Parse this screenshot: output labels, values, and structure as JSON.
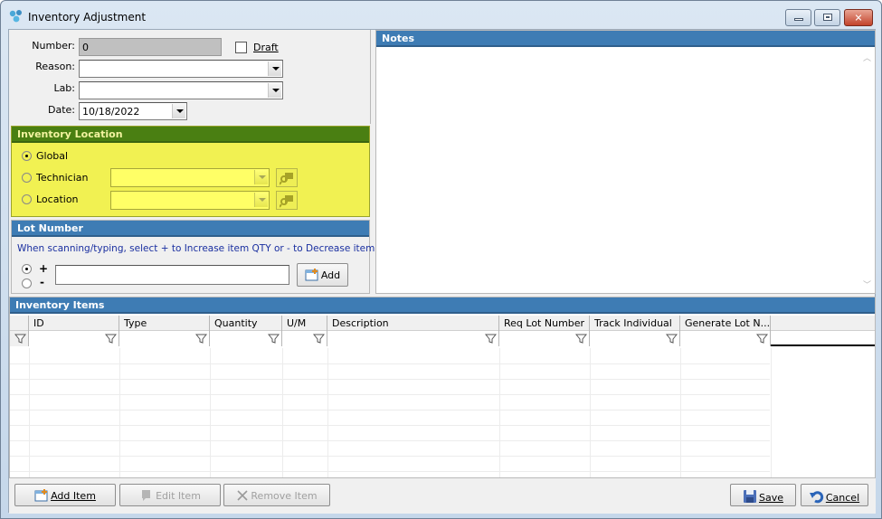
{
  "window": {
    "title": "Inventory Adjustment",
    "controls": {
      "minimize": "minimize",
      "maximize": "maximize",
      "close": "✕"
    }
  },
  "header_form": {
    "number_label": "Number:",
    "number_value": "0",
    "draft_label": "Draft",
    "draft_checked": false,
    "reason_label": "Reason:",
    "reason_value": "",
    "lab_label": "Lab:",
    "lab_value": "",
    "date_label": "Date:",
    "date_value": "10/18/2022"
  },
  "inventory_location": {
    "title": "Inventory Location",
    "options": [
      {
        "label": "Global",
        "selected": true
      },
      {
        "label": "Technician",
        "selected": false,
        "value": ""
      },
      {
        "label": "Location",
        "selected": false,
        "value": ""
      }
    ]
  },
  "lot_number": {
    "title": "Lot Number",
    "hint": "When scanning/typing, select + to Increase item QTY or - to Decrease item QTY",
    "plus_label": "+",
    "minus_label": "-",
    "mode": "+",
    "input_value": "",
    "add_label": "Add"
  },
  "notes": {
    "title": "Notes",
    "text": ""
  },
  "inventory_items": {
    "title": "Inventory Items",
    "columns": [
      "ID",
      "Type",
      "Quantity",
      "U/M",
      "Description",
      "Req Lot Number",
      "Track Individual",
      "Generate Lot N..."
    ],
    "rows": []
  },
  "footer": {
    "add_item": "Add Item",
    "edit_item": "Edit Item",
    "remove_item": "Remove Item",
    "save": "Save",
    "cancel": "Cancel"
  },
  "colors": {
    "section_blue": "#3e7cb4",
    "section_green": "#4a7f12",
    "location_yellow": "#f1f152",
    "hint_text": "#1a2fa0"
  }
}
